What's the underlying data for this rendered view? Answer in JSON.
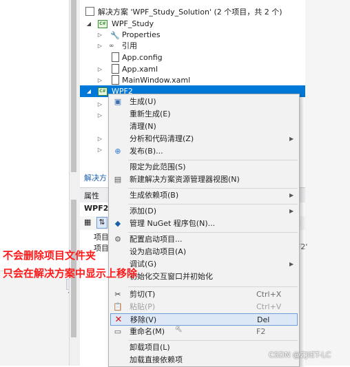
{
  "solution_explorer": {
    "solution_label": "解决方案 'WPF_Study_Solution' (2 个项目，共 2 个)",
    "project1": "WPF_Study",
    "items": [
      "Properties",
      "引用",
      "App.config",
      "App.xaml",
      "MainWindow.xaml"
    ],
    "project2": "WPF2",
    "tab_partial": "解决方",
    "properties_label": "属性",
    "properties_object": "WPF2",
    "prop_row1": "项目文",
    "prop_row2": "项目",
    "prop_right_partial": "F2'"
  },
  "context_menu": {
    "items": [
      {
        "label": "生成(U)",
        "icon": "build-icon"
      },
      {
        "label": "重新生成(E)"
      },
      {
        "label": "清理(N)"
      },
      {
        "label": "分析和代码清理(Z)",
        "submenu": true
      },
      {
        "label": "发布(B)...",
        "icon": "publish-icon"
      },
      {
        "label": "限定为此范围(S)"
      },
      {
        "label": "新建解决方案资源管理器视图(N)",
        "icon": "new-view-icon"
      },
      {
        "label": "生成依赖项(B)",
        "submenu": true
      },
      {
        "label": "添加(D)",
        "submenu": true
      },
      {
        "label": "管理 NuGet 程序包(N)...",
        "icon": "nuget-icon"
      },
      {
        "label": "配置启动项目...",
        "icon": "gear-icon"
      },
      {
        "label": "设为启动项目(A)"
      },
      {
        "label": "调试(G)",
        "submenu": true
      },
      {
        "label": "初始化交互窗口并初始化"
      },
      {
        "label": "剪切(T)",
        "shortcut": "Ctrl+X",
        "icon": "cut-icon"
      },
      {
        "label": "粘贴(P)",
        "shortcut": "Ctrl+V",
        "icon": "paste-icon",
        "disabled": true
      },
      {
        "label": "移除(V)",
        "shortcut": "Del",
        "icon": "remove-icon",
        "highlighted": true
      },
      {
        "label": "重命名(M)",
        "shortcut": "F2",
        "icon": "rename-icon"
      },
      {
        "label": "卸载项目(L)"
      },
      {
        "label": "加载直接依赖项"
      }
    ]
  },
  "annotations": {
    "line1": "不会删除项目文件夹",
    "line2": "只会在解决方案中显示上移除"
  },
  "watermark": "CSDN @ZJIET-LC",
  "colors": {
    "selection": "#0078d7",
    "annotation": "#ff1a1a",
    "menu_highlight": "#dde8f6"
  }
}
